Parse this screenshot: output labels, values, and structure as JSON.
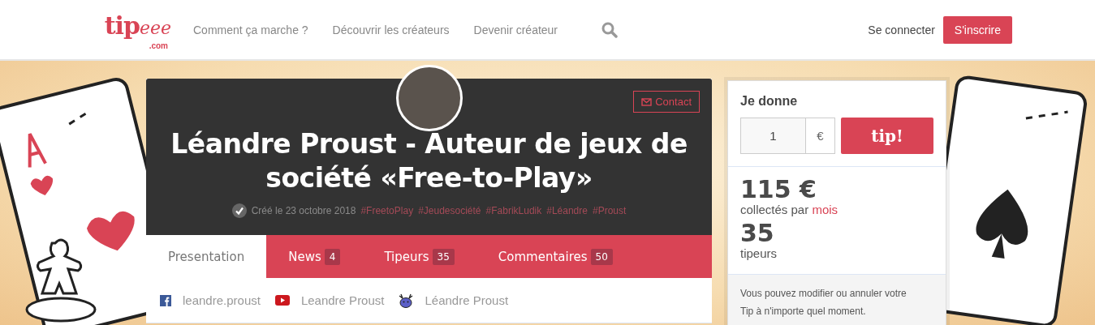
{
  "logo": {
    "main": "tip",
    "script": "eee",
    "domain": ".com"
  },
  "nav": [
    "Comment ça marche ?",
    "Découvrir les créateurs",
    "Devenir créateur"
  ],
  "login": "Se connecter",
  "signup": "S'inscrire",
  "creator": {
    "contact": "Contact",
    "title": "Léandre Proust - Auteur de jeux de société «Free-to-Play»",
    "verified": true,
    "created": "Créé le 23 octobre 2018",
    "tags": [
      "#FreetoPlay",
      "#Jeudesociété",
      "#FabrikLudik",
      "#Léandre",
      "#Proust"
    ]
  },
  "tabs": [
    {
      "label": "Presentation",
      "selected": true
    },
    {
      "label": "News",
      "count": "4",
      "selected": false
    },
    {
      "label": "Tipeurs",
      "count": "35",
      "selected": false
    },
    {
      "label": "Commentaires",
      "count": "50",
      "selected": false
    }
  ],
  "socials": [
    {
      "kind": "facebook",
      "label": "leandre.proust"
    },
    {
      "kind": "youtube",
      "label": "Leandre Proust"
    },
    {
      "kind": "mascot",
      "label": "Léandre Proust"
    }
  ],
  "donate": {
    "heading": "Je donne",
    "amount": "1",
    "currency": "€",
    "button": "tip!"
  },
  "stats": {
    "total": "115 €",
    "total_label": "collectés par",
    "period": "mois",
    "tipers": "35",
    "tipers_label": "tipeurs"
  },
  "note": "Vous pouvez modifier ou annuler votre Tip à n'importe quel moment."
}
